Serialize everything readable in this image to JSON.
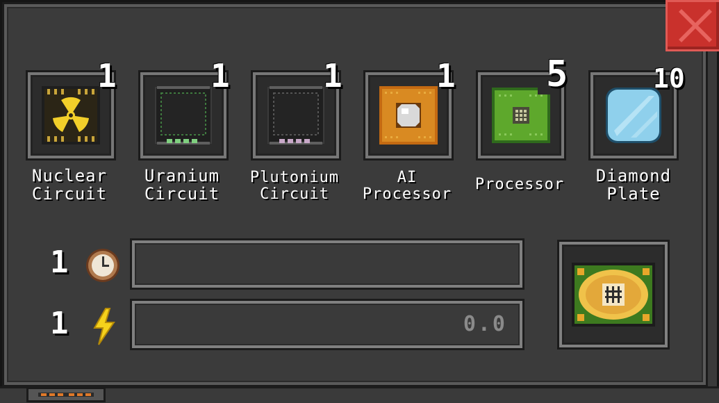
{
  "ingredients": [
    {
      "name_line1": "Nuclear",
      "name_line2": "Circuit",
      "qty": "1",
      "icon": "nuclear-circuit-icon"
    },
    {
      "name_line1": "Uranium",
      "name_line2": "Circuit",
      "qty": "1",
      "icon": "uranium-circuit-icon"
    },
    {
      "name_line1": "Plutonium",
      "name_line2": "Circuit",
      "qty": "1",
      "icon": "plutonium-circuit-icon"
    },
    {
      "name_line1": "AI",
      "name_line2": "Processor",
      "qty": "1",
      "icon": "ai-processor-icon"
    },
    {
      "name_line1": "Processor",
      "name_line2": "",
      "qty": "5",
      "icon": "processor-icon"
    },
    {
      "name_line1": "Diamond",
      "name_line2": "Plate",
      "qty": "10",
      "icon": "diamond-plate-icon"
    }
  ],
  "stats": {
    "time_count": "1",
    "power_count": "1",
    "power_value": "0.0"
  },
  "output": {
    "icon": "quantum-processor-icon"
  },
  "colors": {
    "close": "#c9312c",
    "panel": "#3b3b3b",
    "bolt": "#f5d21c"
  }
}
